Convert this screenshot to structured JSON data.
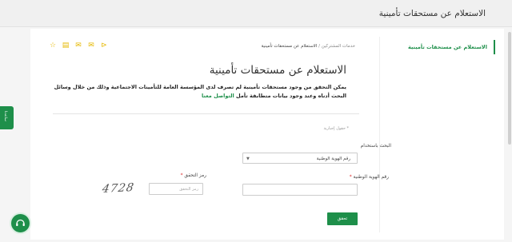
{
  "header": {
    "title": "الاستعلام عن مستحقات تأمينية"
  },
  "sidebar": {
    "active_item": "الاستعلام عن مستحقات تأمينية"
  },
  "toolbar": {
    "icons": [
      "share-icon",
      "email-icon",
      "envelope-icon",
      "print-icon",
      "star-icon"
    ]
  },
  "breadcrumb": {
    "parent": "خدمات المشتركين",
    "separator": "/",
    "current": "الاستعلام عن مستحقات تأمينية"
  },
  "main": {
    "title": "الاستعلام عن مستحقات تأمينية",
    "description": "يمكن التحقق من وجود مستحقات تأمينية لم تصرف لدى المؤسسة العامة للتأمينات الاجتماعية وذلك من خلال وسائل البحث أدناه وعند وجود بيانات متطابقة تأمل ",
    "description_link": "التواصل معنا"
  },
  "form": {
    "required_note": "* حقول إجبارية",
    "search_by_label": "البحث باستخدام",
    "search_by_value": "رقم الهوية الوطنية",
    "national_id_label": "رقم الهوية الوطنية",
    "national_id_value": "",
    "captcha_label": "رمز التحقق",
    "captcha_placeholder": "رمز التحقق",
    "captcha_value": "",
    "captcha_text": "4728",
    "submit_label": "تحقق",
    "required_mark": "*"
  },
  "help_tab": {
    "label": "ساعدنا"
  },
  "colors": {
    "accent": "#1e8f4a",
    "icon": "#e6b800"
  }
}
